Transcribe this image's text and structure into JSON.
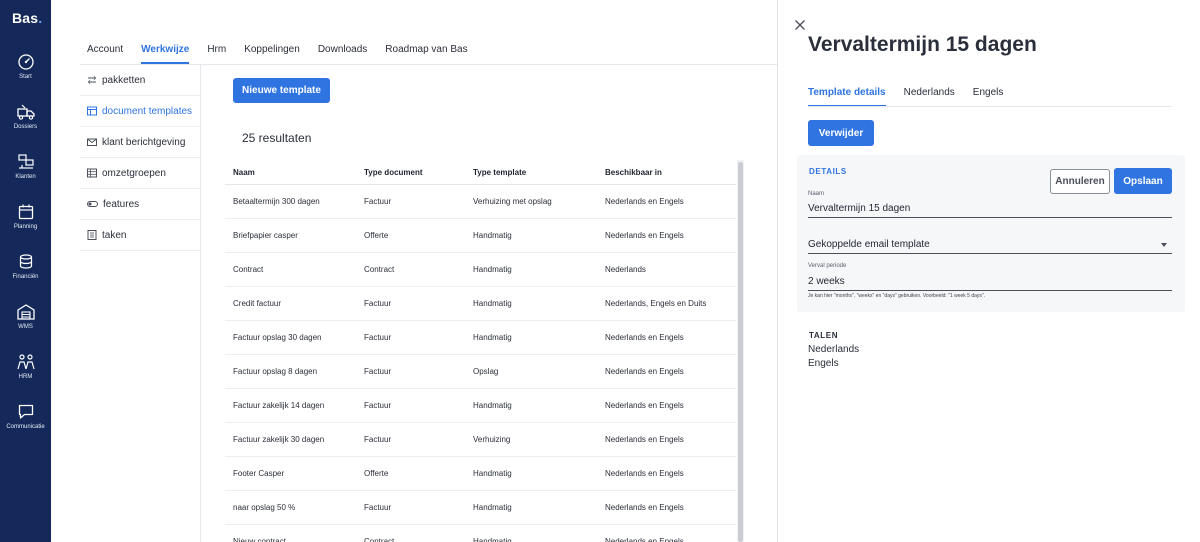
{
  "app": {
    "logo": "Bas",
    "logo_dot": "."
  },
  "leftnav": [
    {
      "label": "Start",
      "icon": "dashboard-icon"
    },
    {
      "label": "Dossiers",
      "icon": "moving-truck-icon"
    },
    {
      "label": "Klanten",
      "icon": "customers-icon"
    },
    {
      "label": "Planning",
      "icon": "calendar-icon"
    },
    {
      "label": "Financiën",
      "icon": "coins-icon"
    },
    {
      "label": "WMS",
      "icon": "warehouse-icon"
    },
    {
      "label": "HRM",
      "icon": "people-icon"
    },
    {
      "label": "Communicatie",
      "icon": "chat-icon"
    }
  ],
  "tabs": [
    "Account",
    "Werkwijze",
    "Hrm",
    "Koppelingen",
    "Downloads",
    "Roadmap van Bas"
  ],
  "sidemenu": [
    {
      "label": "pakketten",
      "icon": "packages-icon"
    },
    {
      "label": "document templates",
      "icon": "document-template-icon"
    },
    {
      "label": "klant berichtgeving",
      "icon": "mail-icon"
    },
    {
      "label": "omzetgroepen",
      "icon": "table-icon"
    },
    {
      "label": "features",
      "icon": "toggle-icon"
    },
    {
      "label": "taken",
      "icon": "tasks-icon"
    }
  ],
  "main": {
    "new_button": "Nieuwe template",
    "results": "25 resultaten",
    "columns": [
      "Naam",
      "Type document",
      "Type template",
      "Beschikbaar in"
    ],
    "rows": [
      [
        "Betaaltermijn 300 dagen",
        "Factuur",
        "Verhuizing met opslag",
        "Nederlands en Engels"
      ],
      [
        "Briefpapier casper",
        "Offerte",
        "Handmatig",
        "Nederlands en Engels"
      ],
      [
        "Contract",
        "Contract",
        "Handmatig",
        "Nederlands"
      ],
      [
        "Credit factuur",
        "Factuur",
        "Handmatig",
        "Nederlands, Engels en Duits"
      ],
      [
        "Factuur opslag 30 dagen",
        "Factuur",
        "Handmatig",
        "Nederlands en Engels"
      ],
      [
        "Factuur opslag 8 dagen",
        "Factuur",
        "Opslag",
        "Nederlands en Engels"
      ],
      [
        "Factuur zakelijk 14 dagen",
        "Factuur",
        "Handmatig",
        "Nederlands en Engels"
      ],
      [
        "Factuur zakelijk 30 dagen",
        "Factuur",
        "Verhuizing",
        "Nederlands en Engels"
      ],
      [
        "Footer Casper",
        "Offerte",
        "Handmatig",
        "Nederlands en Engels"
      ],
      [
        "naar opslag 50 %",
        "Factuur",
        "Handmatig",
        "Nederlands en Engels"
      ],
      [
        "Nieuw contract",
        "Contract",
        "Handmatig",
        "Nederlands en Engels"
      ]
    ]
  },
  "panel": {
    "title": "Vervaltermijn 15 dagen",
    "tabs": [
      "Template details",
      "Nederlands",
      "Engels"
    ],
    "delete_button": "Verwijder",
    "details_title": "DETAILS",
    "cancel_button": "Annuleren",
    "save_button": "Opslaan",
    "name_label": "Naam",
    "name_value": "Vervaltermijn 15 dagen",
    "email_template_label": "Gekoppelde email template",
    "period_label": "Verval periode",
    "period_value": "2 weeks",
    "period_hint": "Je kan hier \"months\", \"weeks\" en \"days\" gebruiken. Voorbeeld: \"1 week 5 days\".",
    "languages_title": "TALEN",
    "languages": [
      "Nederlands",
      "Engels"
    ]
  },
  "colors": {
    "nav_bg": "#14295a",
    "accent": "#2f74e0",
    "details_title": "#2f74e0"
  }
}
